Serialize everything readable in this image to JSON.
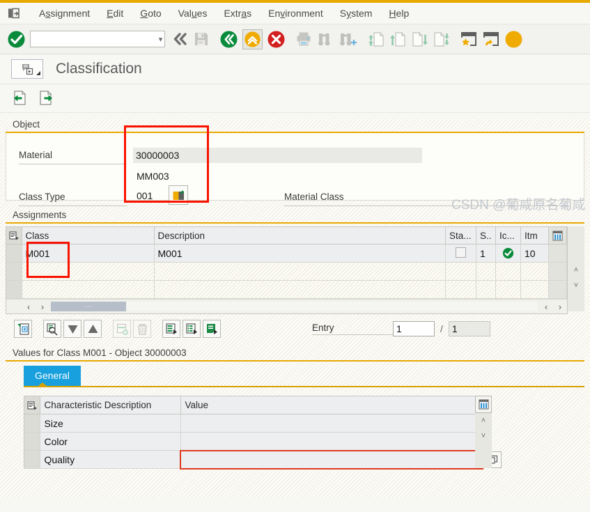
{
  "menubar": {
    "system_icon": "system-menu-icon",
    "items": [
      {
        "label": "Assignment",
        "accel_index": 1
      },
      {
        "label": "Edit",
        "accel_index": 0
      },
      {
        "label": "Goto",
        "accel_index": 0
      },
      {
        "label": "Values",
        "accel_index": 3
      },
      {
        "label": "Extras",
        "accel_index": 4
      },
      {
        "label": "Environment",
        "accel_index": 2
      },
      {
        "label": "System",
        "accel_index": 1
      },
      {
        "label": "Help",
        "accel_index": 0
      }
    ]
  },
  "toolbar": {
    "command_field_value": "",
    "command_field_placeholder": "",
    "buttons": [
      {
        "name": "enter-check-icon",
        "title": "Enter"
      },
      {
        "name": "history-back-double-icon",
        "title": "Back history"
      },
      {
        "name": "save-icon",
        "title": "Save"
      },
      {
        "name": "back-green-icon",
        "title": "Back"
      },
      {
        "name": "exit-up-icon",
        "title": "Exit",
        "pressed": true
      },
      {
        "name": "cancel-red-icon",
        "title": "Cancel"
      },
      {
        "name": "print-icon",
        "title": "Print"
      },
      {
        "name": "find-icon",
        "title": "Find"
      },
      {
        "name": "find-next-icon",
        "title": "Find Next"
      },
      {
        "name": "first-page-icon",
        "title": "First page"
      },
      {
        "name": "previous-page-icon",
        "title": "Previous page"
      },
      {
        "name": "next-page-icon",
        "title": "Next page"
      },
      {
        "name": "last-page-icon",
        "title": "Last page"
      },
      {
        "name": "create-session-icon",
        "title": "Create session"
      },
      {
        "name": "create-shortcut-icon",
        "title": "Create shortcut"
      },
      {
        "name": "help-icon",
        "title": "Help"
      }
    ]
  },
  "title": {
    "icon": "classification-screen-icon",
    "text": "Classification"
  },
  "app_toolbar": {
    "buttons": [
      {
        "name": "previous-object-icon",
        "title": "Previous object"
      },
      {
        "name": "next-object-icon",
        "title": "Next object"
      }
    ]
  },
  "object_section": {
    "group_label": "Object",
    "material_label": "Material",
    "material_value": "30000003",
    "material_description": "MM003",
    "class_type_label": "Class Type",
    "class_type_value": "001",
    "class_type_icon": "class-type-picker-icon",
    "material_class_label": "Material Class"
  },
  "assignments_section": {
    "group_label": "Assignments",
    "columns": [
      "Class",
      "Description",
      "Sta...",
      "S..",
      "Ic...",
      "Itm"
    ],
    "rows": [
      {
        "class": "M001",
        "description": "M001",
        "status_checkbox": false,
        "s": "1",
        "ic": "status-ok-icon",
        "itm": "10"
      },
      {
        "class": "",
        "description": "",
        "s": "",
        "ic": "",
        "itm": ""
      },
      {
        "class": "",
        "description": "",
        "s": "",
        "ic": "",
        "itm": ""
      }
    ],
    "config_icon": "table-settings-icon",
    "row_header_icon": "select-all-icon",
    "hscroll": {
      "left_arrow": "‹",
      "right_arrow": "›",
      "thumb_glyph": "⋯"
    },
    "vscroll": {
      "up": "˄",
      "down": "˅"
    },
    "toolbar_buttons": [
      {
        "name": "new-entries-icon",
        "title": "New entries"
      },
      {
        "name": "find-class-icon",
        "title": "Find"
      },
      {
        "name": "sort-descending-icon",
        "title": "Sort descending"
      },
      {
        "name": "sort-ascending-icon",
        "title": "Sort ascending"
      },
      {
        "name": "insert-row-icon",
        "title": "Insert row",
        "disabled": true
      },
      {
        "name": "delete-row-icon",
        "title": "Delete row",
        "disabled": true
      },
      {
        "name": "detail-list-1-icon",
        "title": "Details"
      },
      {
        "name": "detail-list-2-icon",
        "title": "Details"
      },
      {
        "name": "detail-list-3-icon",
        "title": "Details"
      }
    ],
    "entry_label": "Entry",
    "entry_current": "1",
    "entry_separator": "/",
    "entry_total": "1"
  },
  "values_section": {
    "title": "Values for Class M001 - Object 30000003",
    "tabs": [
      {
        "label": "General",
        "active": true
      }
    ],
    "columns": [
      "Characteristic Description",
      "Value"
    ],
    "rows": [
      {
        "characteristic": "Size",
        "value": ""
      },
      {
        "characteristic": "Color",
        "value": ""
      },
      {
        "characteristic": "Quality",
        "value": "",
        "active": true
      }
    ],
    "config_icon": "table-settings-icon",
    "row_header_icon": "select-all-icon",
    "expand_icon": "expand-value-icon",
    "vscroll": {
      "up": "˄",
      "down": "˅"
    }
  },
  "watermark": {
    "text": "CSDN @葡咸原名葡咸"
  },
  "colors": {
    "accent_gold": "#e8a900",
    "tab_blue": "#17a0dd",
    "highlight_red": "#fa1200",
    "status_green": "#0f8a3c",
    "cancel_red": "#d32020"
  }
}
